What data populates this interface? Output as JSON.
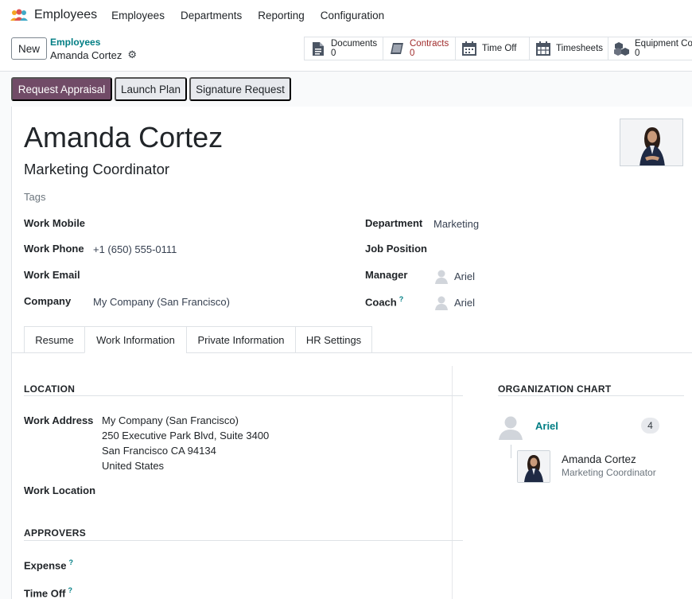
{
  "topnav": {
    "app_name": "Employees",
    "menus": [
      "Employees",
      "Departments",
      "Reporting",
      "Configuration"
    ]
  },
  "control": {
    "new_label": "New",
    "breadcrumb": "Employees",
    "record_name": "Amanda Cortez",
    "smart_buttons": [
      {
        "label": "Documents",
        "count": "0",
        "icon": "document-icon"
      },
      {
        "label": "Contracts",
        "count": "0",
        "icon": "book-icon",
        "accent": "#a02c2c"
      },
      {
        "label": "Time Off",
        "icon": "calendar-icon"
      },
      {
        "label": "Timesheets",
        "icon": "calendar-grid-icon"
      },
      {
        "label": "Equipment Cou",
        "count": "0",
        "icon": "cubes-icon"
      }
    ]
  },
  "actions": {
    "request_appraisal": "Request Appraisal",
    "launch_plan": "Launch Plan",
    "signature_request": "Signature Request"
  },
  "employee": {
    "name": "Amanda Cortez",
    "job_title": "Marketing Coordinator",
    "tags_placeholder": "Tags"
  },
  "fields_left": [
    {
      "label": "Work Mobile",
      "value": ""
    },
    {
      "label": "Work Phone",
      "value": "+1 (650) 555-0111"
    },
    {
      "label": "Work Email",
      "value": ""
    },
    {
      "label": "Company",
      "value": "My Company (San Francisco)"
    }
  ],
  "fields_right": [
    {
      "label": "Department",
      "value": "Marketing"
    },
    {
      "label": "Job Position",
      "value": ""
    },
    {
      "label": "Manager",
      "value": "Ariel"
    },
    {
      "label": "Coach",
      "help": "?",
      "value": "Ariel"
    }
  ],
  "tabs": [
    "Resume",
    "Work Information",
    "Private Information",
    "HR Settings"
  ],
  "active_tab": "Work Information",
  "location": {
    "heading": "LOCATION",
    "work_address_label": "Work Address",
    "address_lines": [
      "My Company (San Francisco)",
      "250 Executive Park Blvd, Suite 3400",
      "San Francisco CA 94134",
      "United States"
    ],
    "work_location_label": "Work Location"
  },
  "approvers": {
    "heading": "APPROVERS",
    "expense_label": "Expense",
    "time_off_label": "Time Off",
    "help": "?"
  },
  "org_chart": {
    "heading": "ORGANIZATION CHART",
    "manager_name": "Ariel",
    "manager_count": "4",
    "employee_name": "Amanda Cortez",
    "employee_title": "Marketing Coordinator"
  },
  "colors": {
    "primary": "#714b67",
    "teal": "#017e84",
    "contracts_red": "#a02c2c"
  }
}
